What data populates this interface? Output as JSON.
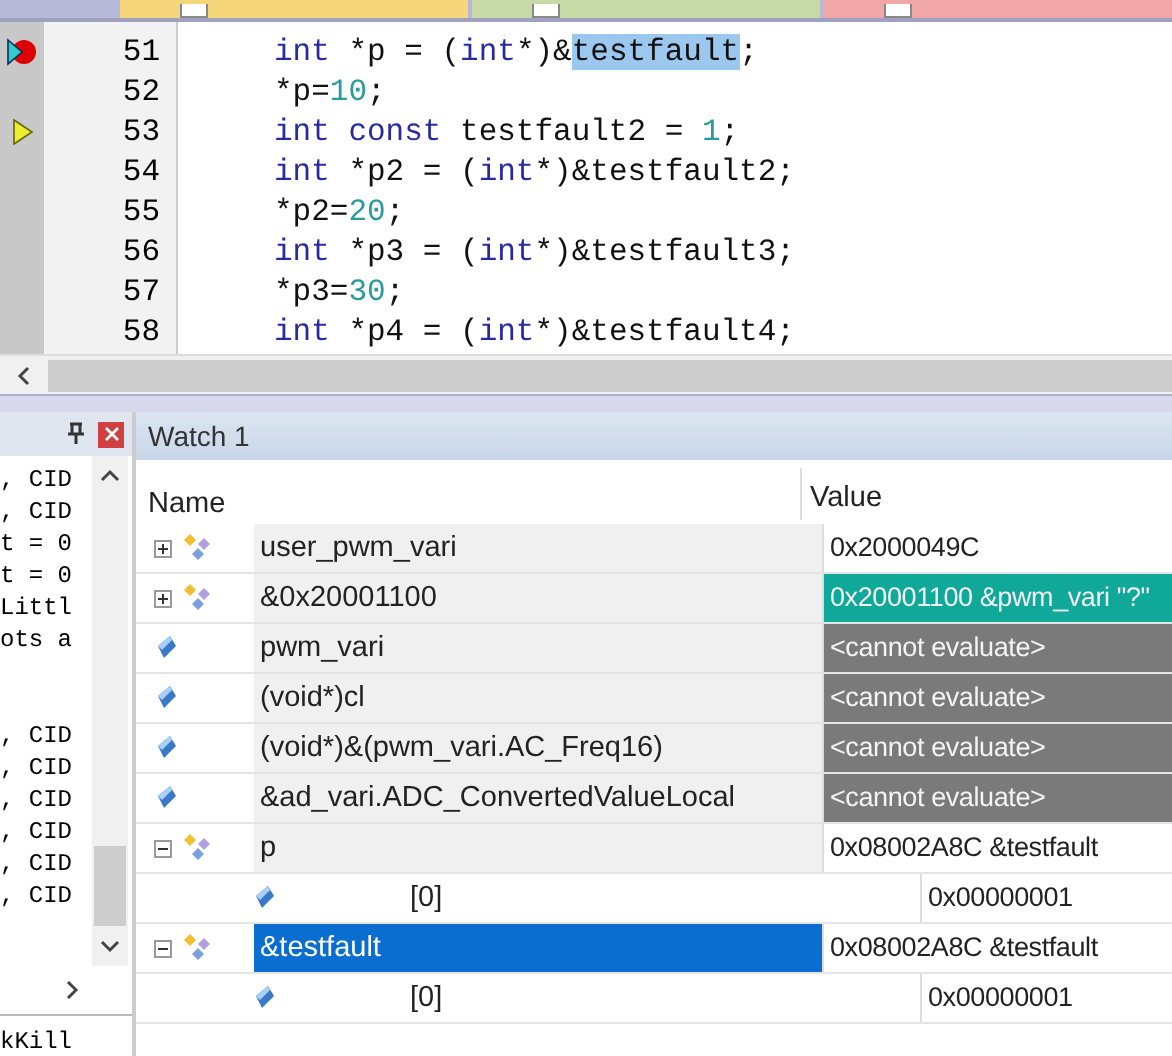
{
  "file_tabs": [
    {
      "color": "#f5d67a",
      "selected": false
    },
    {
      "color": "#c8d9a8",
      "selected": false
    },
    {
      "color": "#f2a8a8",
      "selected": false
    }
  ],
  "editor": {
    "lines": [
      {
        "number": "51",
        "kind": "breakpoint",
        "tokens": [
          {
            "kind": "kw",
            "t": "int"
          },
          {
            "kind": "plain",
            "t": " *p = ("
          },
          {
            "kind": "kw",
            "t": "int"
          },
          {
            "kind": "plain",
            "t": "*)&"
          },
          {
            "kind": "sel",
            "t": "testfault"
          },
          {
            "kind": "plain",
            "t": ";"
          }
        ]
      },
      {
        "number": "52",
        "kind": "plain",
        "tokens": [
          {
            "kind": "plain",
            "t": "*p="
          },
          {
            "kind": "num",
            "t": "10"
          },
          {
            "kind": "plain",
            "t": ";"
          }
        ]
      },
      {
        "number": "53",
        "kind": "pointer",
        "tokens": [
          {
            "kind": "kw",
            "t": "int const"
          },
          {
            "kind": "plain",
            "t": " testfault2 = "
          },
          {
            "kind": "num",
            "t": "1"
          },
          {
            "kind": "plain",
            "t": ";"
          }
        ]
      },
      {
        "number": "54",
        "kind": "plain",
        "tokens": [
          {
            "kind": "kw",
            "t": "int"
          },
          {
            "kind": "plain",
            "t": " *p2 = ("
          },
          {
            "kind": "kw",
            "t": "int"
          },
          {
            "kind": "plain",
            "t": "*)&testfault2;"
          }
        ]
      },
      {
        "number": "55",
        "kind": "plain",
        "tokens": [
          {
            "kind": "plain",
            "t": "*p2="
          },
          {
            "kind": "num",
            "t": "20"
          },
          {
            "kind": "plain",
            "t": ";"
          }
        ]
      },
      {
        "number": "56",
        "kind": "plain",
        "tokens": [
          {
            "kind": "kw",
            "t": "int"
          },
          {
            "kind": "plain",
            "t": " *p3 = ("
          },
          {
            "kind": "kw",
            "t": "int"
          },
          {
            "kind": "plain",
            "t": "*)&testfault3;"
          }
        ]
      },
      {
        "number": "57",
        "kind": "plain",
        "tokens": [
          {
            "kind": "plain",
            "t": "*p3="
          },
          {
            "kind": "num",
            "t": "30"
          },
          {
            "kind": "plain",
            "t": ";"
          }
        ]
      },
      {
        "number": "58",
        "kind": "plain",
        "tokens": [
          {
            "kind": "kw",
            "t": "int"
          },
          {
            "kind": "plain",
            "t": " *p4 = ("
          },
          {
            "kind": "kw",
            "t": "int"
          },
          {
            "kind": "plain",
            "t": "*)&testfault4;"
          }
        ]
      }
    ]
  },
  "output_panel": {
    "blocks": [
      [
        ", CID",
        ", CID",
        "t = 0",
        "t = 0",
        "Littl",
        "ots a"
      ],
      [
        ", CID",
        ", CID",
        ", CID",
        ", CID",
        ", CID",
        ", CID"
      ]
    ],
    "footer": "kKill"
  },
  "watch": {
    "title": "Watch 1",
    "columns": [
      "Name",
      "Value"
    ],
    "rows": [
      {
        "name": "user_pwm_vari",
        "value": "0x2000049C",
        "kind": "struct",
        "expanded": false,
        "selected": false
      },
      {
        "name": "&0x20001100",
        "value": "0x20001100 &pwm_vari \"?\"",
        "kind": "struct",
        "expanded": false,
        "color": "#10a898",
        "selected": false
      },
      {
        "name": "pwm_vari",
        "value": "<cannot evaluate>",
        "kind": "var",
        "color": "#7a7a7a",
        "selected": false
      },
      {
        "name": "(void*)cl",
        "value": "<cannot evaluate>",
        "kind": "var",
        "color": "#7a7a7a",
        "selected": false
      },
      {
        "name": "(void*)&(pwm_vari.AC_Freq16)",
        "value": "<cannot evaluate>",
        "kind": "var",
        "color": "#7a7a7a",
        "selected": false
      },
      {
        "name": "&ad_vari.ADC_ConvertedValueLocal",
        "value": "<cannot evaluate>",
        "kind": "var",
        "color": "#7a7a7a",
        "selected": false
      },
      {
        "name": "p",
        "value": "0x08002A8C &testfault",
        "kind": "struct",
        "expanded": true,
        "selected": false,
        "children": [
          {
            "name": "[0]",
            "value": "0x00000001",
            "kind": "var",
            "selected": false
          }
        ]
      },
      {
        "name": "&testfault",
        "value": "0x08002A8C &testfault",
        "kind": "struct",
        "expanded": true,
        "selected": true,
        "children": [
          {
            "name": "[0]",
            "value": "0x00000001",
            "kind": "var",
            "selected": false
          }
        ]
      }
    ]
  }
}
